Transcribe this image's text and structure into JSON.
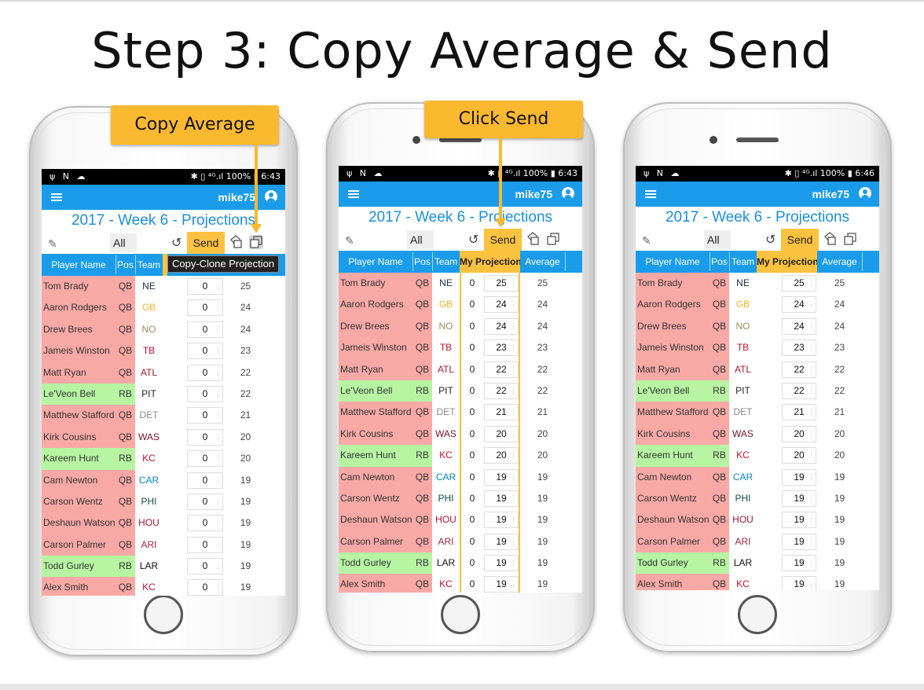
{
  "title": "Step 3: Copy Average & Send",
  "callouts": {
    "copy_average": "Copy Average",
    "click_send": "Click Send",
    "tooltip": "Copy-Clone Projection"
  },
  "colors": {
    "accent_blue": "#1a9cea",
    "highlight_orange": "#fcc240",
    "qb_red": "#f8a9a6",
    "rb_green": "#b7f5a3"
  },
  "header": {
    "username": "mike75",
    "page_title": "2017 - Week 6 - Projections",
    "filter": "All",
    "send_label": "Send"
  },
  "status": {
    "left_icons": "ψ N ☁",
    "phones": [
      {
        "right": "✱ ▯ ⁴ᴳ.ıl 100% ▮ 6:43"
      },
      {
        "right": "✱ ▯ ⁴ᴳ.ıl 100% ▮ 6:43"
      },
      {
        "right": "✱ ▯ ⁴ᴳ.ıl 100% ▮ 6:46"
      }
    ]
  },
  "columns": {
    "player_name": "Player Name",
    "pos": "Pos",
    "team": "Team",
    "my_projection": "My Projection",
    "average": "Average"
  },
  "players": [
    {
      "name": "Tom Brady",
      "pos": "QB",
      "team": "NE",
      "team_color": "#1b2a4a",
      "avg": "25"
    },
    {
      "name": "Aaron Rodgers",
      "pos": "QB",
      "team": "GB",
      "team_color": "#f0b429",
      "avg": "24"
    },
    {
      "name": "Drew Brees",
      "pos": "QB",
      "team": "NO",
      "team_color": "#a08a5a",
      "avg": "24"
    },
    {
      "name": "Jameis Winston",
      "pos": "QB",
      "team": "TB",
      "team_color": "#c8102e",
      "avg": "23"
    },
    {
      "name": "Matt Ryan",
      "pos": "QB",
      "team": "ATL",
      "team_color": "#a71930",
      "avg": "22"
    },
    {
      "name": "Le'Veon Bell",
      "pos": "RB",
      "team": "PIT",
      "team_color": "#222222",
      "avg": "22"
    },
    {
      "name": "Matthew Stafford",
      "pos": "QB",
      "team": "DET",
      "team_color": "#8a8a8a",
      "avg": "21"
    },
    {
      "name": "Kirk Cousins",
      "pos": "QB",
      "team": "WAS",
      "team_color": "#7a1028",
      "avg": "20"
    },
    {
      "name": "Kareem Hunt",
      "pos": "RB",
      "team": "KC",
      "team_color": "#d0102e",
      "avg": "20"
    },
    {
      "name": "Cam Newton",
      "pos": "QB",
      "team": "CAR",
      "team_color": "#0a86c6",
      "avg": "19"
    },
    {
      "name": "Carson Wentz",
      "pos": "QB",
      "team": "PHI",
      "team_color": "#0b4a52",
      "avg": "19"
    },
    {
      "name": "Deshaun Watson",
      "pos": "QB",
      "team": "HOU",
      "team_color": "#b0102e",
      "avg": "19"
    },
    {
      "name": "Carson Palmer",
      "pos": "QB",
      "team": "ARI",
      "team_color": "#97233f",
      "avg": "19"
    },
    {
      "name": "Todd Gurley",
      "pos": "RB",
      "team": "LAR",
      "team_color": "#111111",
      "avg": "19"
    },
    {
      "name": "Alex Smith",
      "pos": "QB",
      "team": "KC",
      "team_color": "#d0102e",
      "avg": "19"
    }
  ],
  "phone1_projection": "0",
  "phone2_zero": "0"
}
